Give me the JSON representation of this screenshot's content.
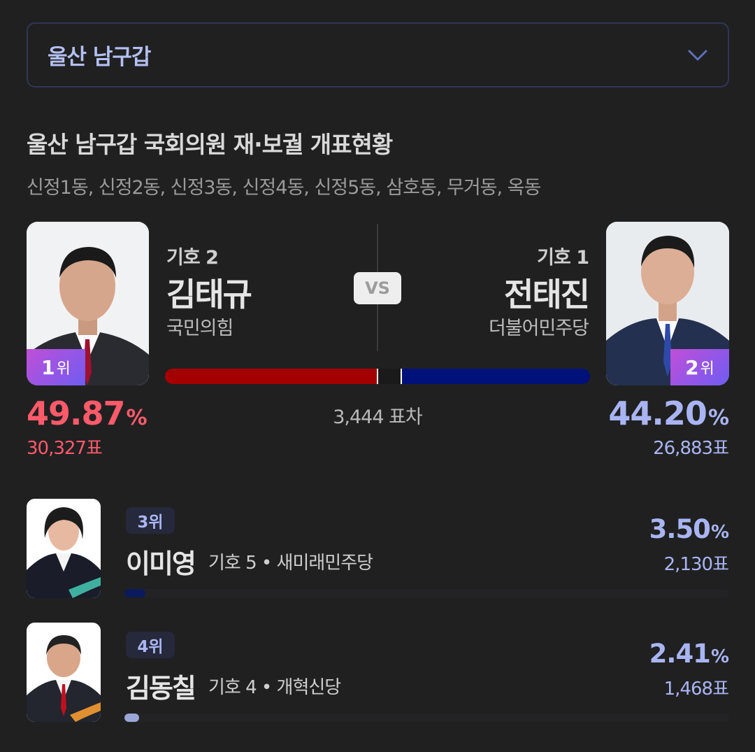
{
  "dropdown": {
    "value": "울산 남구갑"
  },
  "title": "울산 남구갑 국회의원 재·보궐 개표현황",
  "subtitle": "신정1동, 신정2동, 신정3동, 신정4동, 신정5동, 삼호동, 무거동, 옥동",
  "vs_label": "VS",
  "diff_label": "3,444 표차",
  "left": {
    "number": "기호 2",
    "name": "김태규",
    "party": "국민의힘",
    "rank_num": "1",
    "rank_unit": "위",
    "pct": "49.87",
    "pct_symbol": "%",
    "votes": "30,327표",
    "share": 0.4987,
    "color": "#a30000"
  },
  "right": {
    "number": "기호 1",
    "name": "전태진",
    "party": "더불어민주당",
    "rank_num": "2",
    "rank_unit": "위",
    "pct": "44.20",
    "pct_symbol": "%",
    "votes": "26,883표",
    "share": 0.442,
    "color": "#00117a"
  },
  "others": [
    {
      "rank": "3위",
      "name": "이미영",
      "number": "기호 5",
      "sep": "•",
      "party": "새미래민주당",
      "pct": "3.50",
      "pct_symbol": "%",
      "votes": "2,130표",
      "share": 0.035,
      "color": "#0b1a5c"
    },
    {
      "rank": "4위",
      "name": "김동칠",
      "number": "기호 4",
      "sep": "•",
      "party": "개혁신당",
      "pct": "2.41",
      "pct_symbol": "%",
      "votes": "1,468표",
      "share": 0.0241,
      "color": "#9aa6d6"
    }
  ]
}
